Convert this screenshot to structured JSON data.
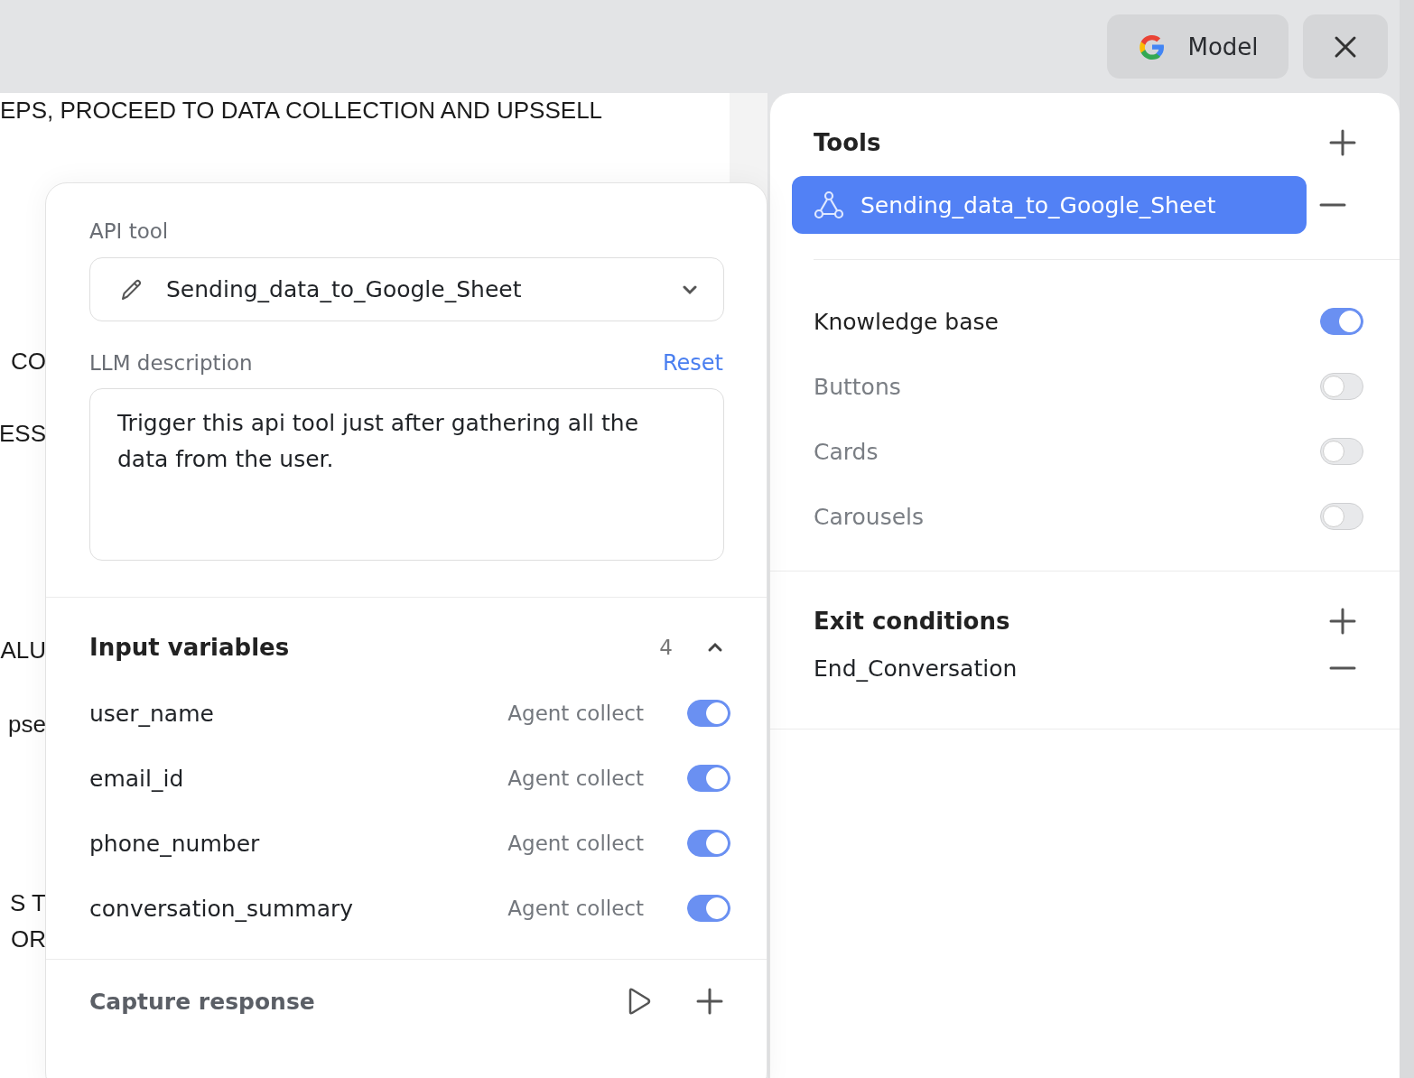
{
  "header": {
    "model_button": "Model"
  },
  "canvas_fragments": [
    {
      "text": "EPS, PROCEED TO DATA COLLECTION AND UPSSELL",
      "kind": "full"
    },
    {
      "text": "CO",
      "kind": "clipped"
    },
    {
      "text": "ESS",
      "kind": "clipped"
    },
    {
      "text": "ALU",
      "kind": "clipped"
    },
    {
      "text": "pse",
      "kind": "clipped"
    },
    {
      "text": "S T",
      "kind": "clipped"
    },
    {
      "text": "OR",
      "kind": "clipped"
    }
  ],
  "api_tool_panel": {
    "api_tool_label": "API tool",
    "selected_tool": "Sending_data_to_Google_Sheet",
    "llm_description_label": "LLM description",
    "reset_link": "Reset",
    "llm_description": "Trigger this api tool just after gathering all the data from the user.",
    "input_variables": {
      "title": "Input variables",
      "count": "4",
      "expanded": true,
      "items": [
        {
          "name": "user_name",
          "collect": "Agent collect",
          "on": true
        },
        {
          "name": "email_id",
          "collect": "Agent collect",
          "on": true
        },
        {
          "name": "phone_number",
          "collect": "Agent collect",
          "on": true
        },
        {
          "name": "conversation_summary",
          "collect": "Agent collect",
          "on": true
        }
      ]
    },
    "capture_response": "Capture response"
  },
  "sidebar": {
    "tools": {
      "title": "Tools",
      "items": [
        {
          "label": "Sending_data_to_Google_Sheet",
          "selected": true
        }
      ]
    },
    "features": [
      {
        "label": "Knowledge base",
        "on": true
      },
      {
        "label": "Buttons",
        "on": false
      },
      {
        "label": "Cards",
        "on": false
      },
      {
        "label": "Carousels",
        "on": false
      }
    ],
    "exit_conditions": {
      "title": "Exit conditions",
      "items": [
        "End_Conversation"
      ]
    }
  }
}
